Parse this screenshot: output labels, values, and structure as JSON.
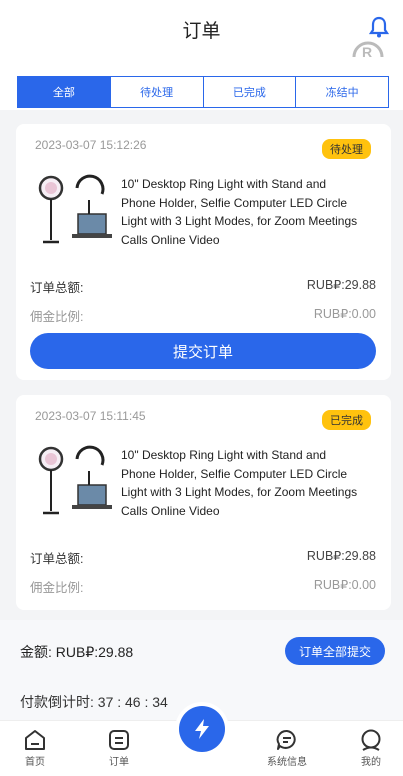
{
  "header": {
    "title": "订单"
  },
  "tabs": [
    {
      "label": "全部",
      "active": true
    },
    {
      "label": "待处理",
      "active": false
    },
    {
      "label": "已完成",
      "active": false
    },
    {
      "label": "冻结中",
      "active": false
    }
  ],
  "orders": [
    {
      "time": "2023-03-07 15:12:26",
      "status": "待处理",
      "product_title": "10\" Desktop Ring Light with Stand and Phone Holder, Selfie Computer LED Circle Light with 3 Light Modes, for Zoom Meetings Calls Online Video",
      "total_label": "订单总额:",
      "total_value": "RUB₽:29.88",
      "commission_label": "佣金比例:",
      "commission_value": "RUB₽:0.00",
      "action_label": "提交订单"
    },
    {
      "time": "2023-03-07 15:11:45",
      "status": "已完成",
      "product_title": "10\" Desktop Ring Light with Stand and Phone Holder, Selfie Computer LED Circle Light with 3 Light Modes, for Zoom Meetings Calls Online Video",
      "total_label": "订单总额:",
      "total_value": "RUB₽:29.88",
      "commission_label": "佣金比例:",
      "commission_value": "RUB₽:0.00"
    }
  ],
  "summary": {
    "amount_text": "金额: RUB₽:29.88",
    "submit_all_label": "订单全部提交",
    "countdown_text": "付款倒计时: 37 : 46 : 34"
  },
  "tabbar": [
    {
      "label": "首页",
      "icon": "home-icon"
    },
    {
      "label": "订单",
      "icon": "order-icon"
    },
    {
      "label": "",
      "icon": "bolt-icon"
    },
    {
      "label": "系统信息",
      "icon": "message-icon"
    },
    {
      "label": "我的",
      "icon": "profile-icon"
    }
  ],
  "colors": {
    "primary": "#2a67ea",
    "badge": "#ffc20e",
    "background": "#f3f4f6"
  }
}
